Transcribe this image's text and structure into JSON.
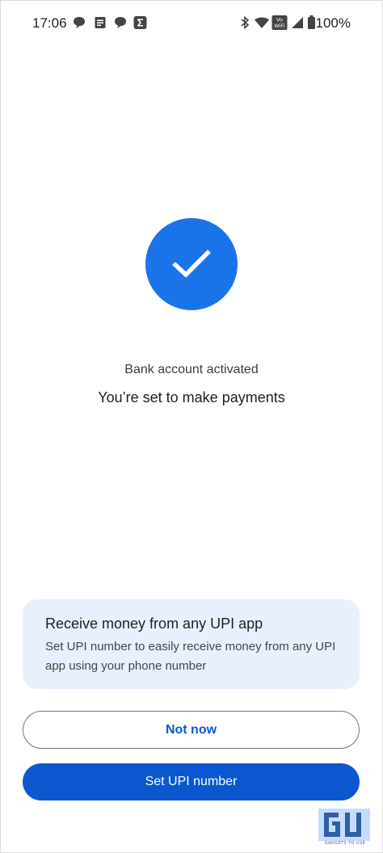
{
  "status_bar": {
    "time": "17:06",
    "battery_percent": "100%",
    "icons": [
      "chat-icon",
      "document-icon",
      "chat-icon",
      "sigma-icon",
      "bluetooth-icon",
      "wifi-icon",
      "vowifi-icon",
      "cellular-signal-icon",
      "battery-icon"
    ],
    "vowifi_label_top": "Vo",
    "vowifi_label_bottom": "WiFi"
  },
  "success": {
    "icon": "checkmark-icon",
    "accent_color": "#1a73e8",
    "subtitle": "Bank account activated",
    "title": "You’re set to make payments"
  },
  "upi_card": {
    "title": "Receive money from any UPI app",
    "description": "Set UPI number to easily receive money from any UPI app using your phone number",
    "background_color": "#e8f0fe"
  },
  "actions": {
    "secondary_label": "Not now",
    "primary_label": "Set UPI number",
    "primary_color": "#0b57d0"
  },
  "watermark": {
    "text": "GADGETS TO USE"
  }
}
